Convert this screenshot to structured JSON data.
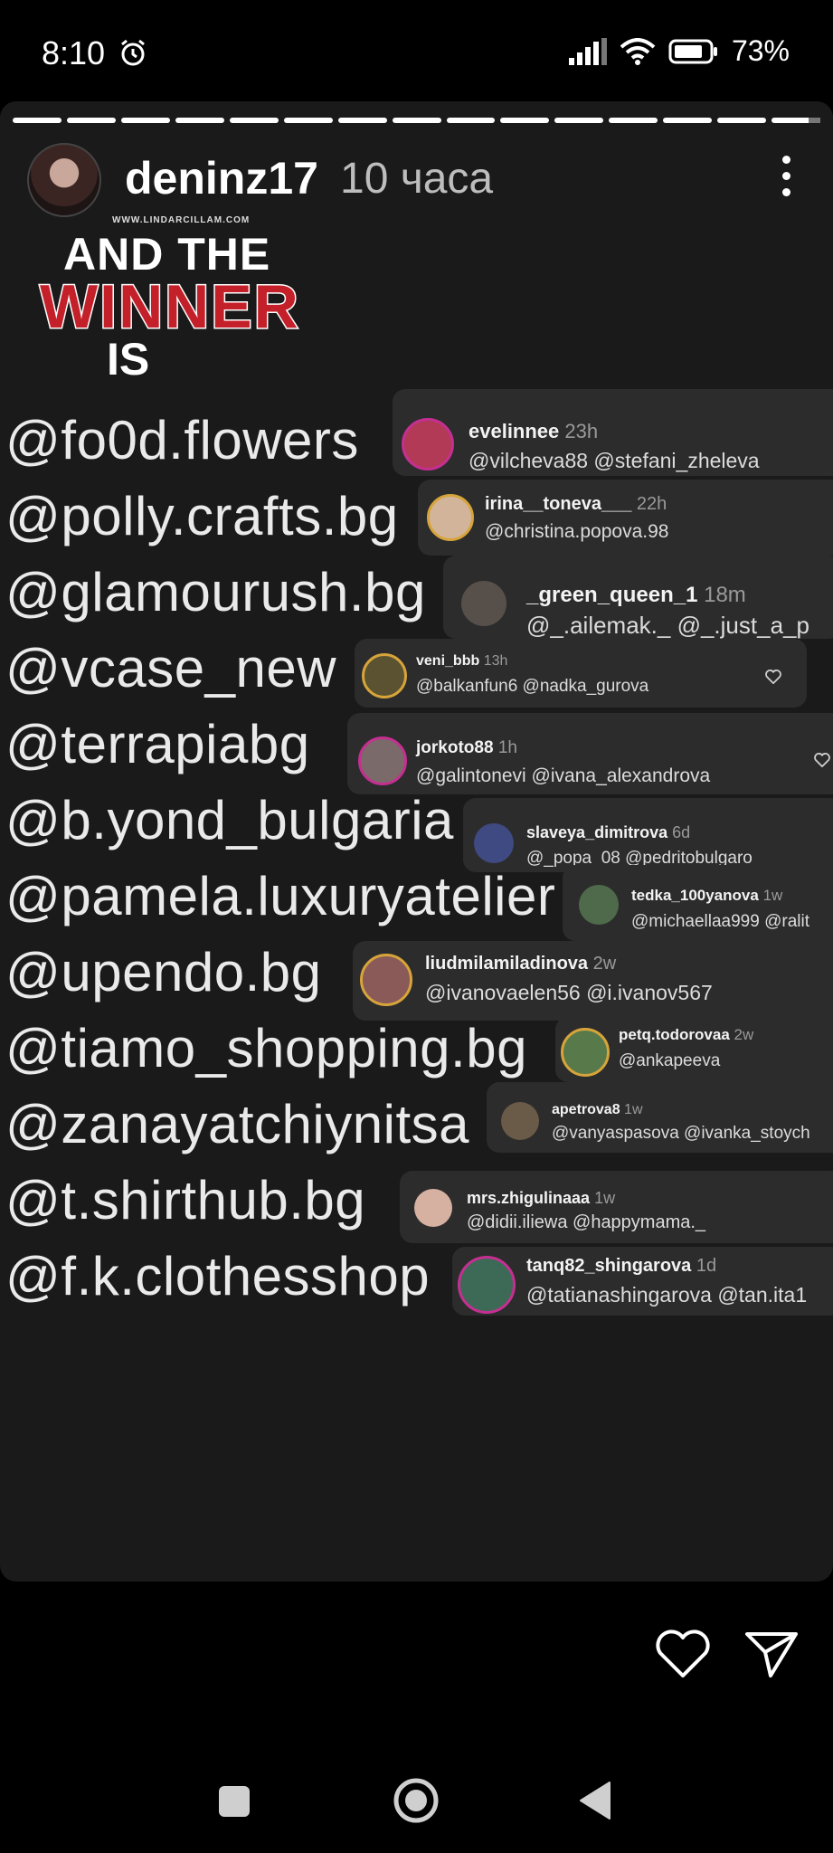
{
  "status_bar": {
    "time": "8:10",
    "battery": "73%"
  },
  "story": {
    "username": "deninz17",
    "time_ago": "10 часа",
    "graphic": {
      "site": "WWW.LINDARCILLAM.COM",
      "line1": "AND THE",
      "line2": "WINNER",
      "line3": "IS"
    },
    "handles": [
      "@fo0d.flowers",
      "@polly.crafts.bg",
      "@glamourush.bg",
      "@vcase_new",
      "@terrapiabg",
      "@b.yond_bulgaria",
      "@pamela.luxuryatelier",
      "@upendo.bg",
      "@tiamo_shopping.bg",
      "@zanayatchiynitsa",
      "@t.shirthub.bg",
      "@f.k.clothesshop"
    ],
    "comments": [
      {
        "name": "evelinnee",
        "ago": "23h",
        "text": "@vilcheva88 @stefani_zheleva"
      },
      {
        "name": "irina__toneva___",
        "ago": "22h",
        "text": "@christina.popova.98"
      },
      {
        "name": "_green_queen_1",
        "ago": "18m",
        "text": "@_.ailemak._ @_.just_a_p"
      },
      {
        "name": "veni_bbb",
        "ago": "13h",
        "text": "@balkanfun6 @nadka_gurova"
      },
      {
        "name": "jorkoto88",
        "ago": "1h",
        "text": "@galintonevi @ivana_alexandrova"
      },
      {
        "name": "slaveya_dimitrova",
        "ago": "6d",
        "text": "@_popa_08 @pedritobulgaro"
      },
      {
        "name": "tedka_100yanova",
        "ago": "1w",
        "text": "@michaellaa999 @ralit"
      },
      {
        "name": "liudmilamiladinova",
        "ago": "2w",
        "text": "@ivanovaelen56 @i.ivanov567"
      },
      {
        "name": "petq.todorovaa",
        "ago": "2w",
        "text": "@ankapeeva"
      },
      {
        "name": "apetrova8",
        "ago": "1w",
        "text": "@vanyaspasova @ivanka_stoych"
      },
      {
        "name": "mrs.zhigulinaaa",
        "ago": "1w",
        "text": "@didii.iliewa @happymama._"
      },
      {
        "name": "tanq82_shingarova",
        "ago": "1d",
        "text": "@tatianashingarova  @tan.ita1"
      }
    ]
  },
  "colors": {
    "background": "#000000",
    "card": "#2c2c2c",
    "winner_red": "#c4202a",
    "story_ring": "#c52f91"
  },
  "icons": [
    "alarm-icon",
    "signal-icon",
    "wifi-icon",
    "battery-icon",
    "more-icon",
    "heart-icon",
    "send-icon",
    "square-nav-icon",
    "home-nav-icon",
    "back-nav-icon"
  ]
}
